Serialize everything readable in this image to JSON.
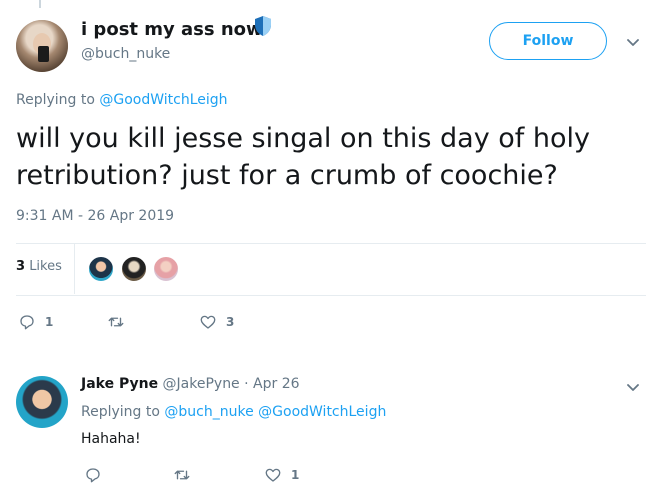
{
  "tweet": {
    "display_name": "i post my ass now",
    "handle": "@buch_nuke",
    "follow_label": "Follow",
    "replying_to_prefix": "Replying to",
    "replying_to_mention": "@GoodWitchLeigh",
    "text": "will you kill jesse singal on this day of holy retribution? just for a crumb of coochie?",
    "timestamp": "9:31 AM - 26 Apr 2019",
    "likes_number": "3",
    "likes_label": "Likes",
    "reply_count": "1",
    "retweet_count": "",
    "like_count": "3"
  },
  "reply": {
    "display_name": "Jake Pyne",
    "handle_and_time": "@JakePyne · Apr 26",
    "replying_to_prefix": "Replying to",
    "mention_1": "@buch_nuke",
    "mention_2": "@GoodWitchLeigh",
    "text": "Hahaha!",
    "reply_count": "",
    "retweet_count": "",
    "like_count": "1"
  },
  "colors": {
    "accent": "#1da1f2",
    "muted": "#657786",
    "text": "#14171a",
    "divider": "#e6ecf0"
  },
  "icons": [
    "shield-icon",
    "chevron-down-icon",
    "reply-icon",
    "retweet-icon",
    "heart-icon"
  ]
}
